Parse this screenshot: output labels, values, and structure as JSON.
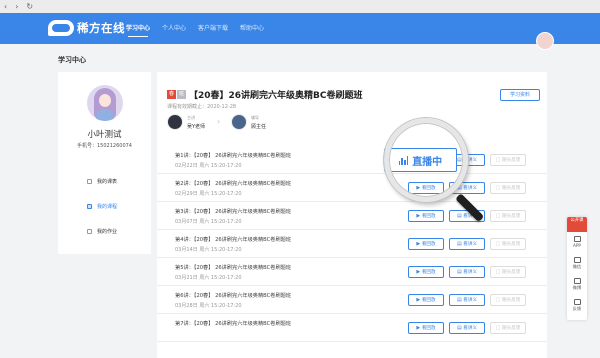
{
  "chrome": {
    "back": "‹",
    "forward": "›",
    "reload": "↻"
  },
  "nav": {
    "logo": "稀方在线",
    "items": [
      "学习中心",
      "个人中心",
      "客户端下载",
      "帮助中心"
    ],
    "active_index": 0
  },
  "page_title": "学习中心",
  "profile": {
    "name": "小叶测试",
    "phone": "手机号：15021260074",
    "menu": [
      "我的课表",
      "我的课程",
      "我的作业"
    ],
    "active_menu_index": 1
  },
  "course": {
    "tag_red": "春",
    "tag_gray": "班",
    "title": "【20春】26讲刷完六年级奥精BC卷刷题班",
    "deadline": "课程有效期截止：2020-12-28",
    "study_materials": "学习资料",
    "teachers": [
      {
        "role": "主讲",
        "name": "吴Y老师"
      },
      {
        "role": "辅导",
        "name": "顾主任"
      }
    ]
  },
  "buttons": {
    "live": "直播中",
    "replay": "看回放",
    "notes": "看讲义",
    "quiz": "随头反馈"
  },
  "lessons": [
    {
      "title": "第1讲：【20春】 26讲刷完六年级奥精BC卷刷题班",
      "time": "02月22日 周六 15:20-17:20",
      "status": "live"
    },
    {
      "title": "第2讲：【20春】 26讲刷完六年级奥精BC卷刷题班",
      "time": "02月29日 周六 15:20-17:20",
      "status": "replay"
    },
    {
      "title": "第3讲：【20春】 26讲刷完六年级奥精BC卷刷题班",
      "time": "03月07日 周六 15:20-17:20",
      "status": "replay"
    },
    {
      "title": "第4讲：【20春】 26讲刷完六年级奥精BC卷刷题班",
      "time": "03月14日 周六 15:20-17:20",
      "status": "replay"
    },
    {
      "title": "第5讲：【20春】 26讲刷完六年级奥精BC卷刷题班",
      "time": "03月21日 周六 15:20-17:20",
      "status": "replay"
    },
    {
      "title": "第6讲：【20春】 26讲刷完六年级奥精BC卷刷题班",
      "time": "03月28日 周六 15:20-17:20",
      "status": "replay"
    },
    {
      "title": "第7讲：【20春】 26讲刷完六年级奥精BC卷刷题班",
      "time": "",
      "status": "replay"
    }
  ],
  "float_bar": {
    "hot": "公开课",
    "items": [
      "APP",
      "微信",
      "微博",
      "反馈"
    ]
  },
  "colors": {
    "primary": "#3a86e8",
    "accent_red": "#e24b39"
  }
}
